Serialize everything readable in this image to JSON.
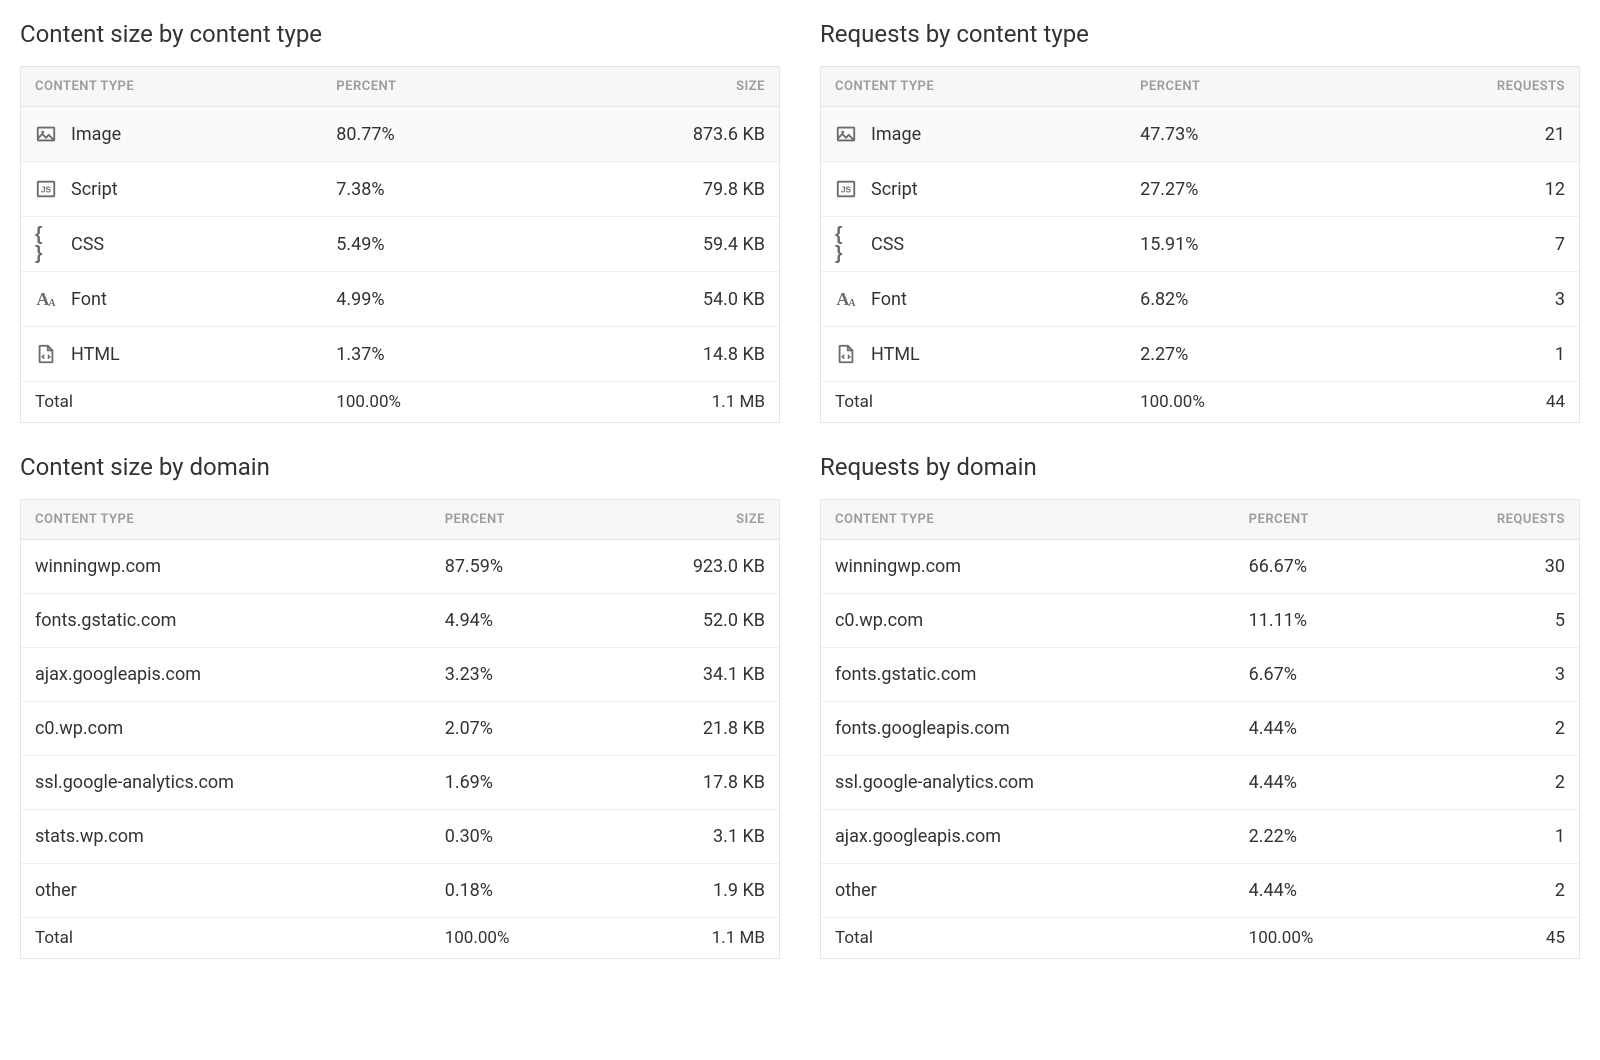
{
  "headers": {
    "content_type": "CONTENT TYPE",
    "percent": "PERCENT",
    "size": "SIZE",
    "requests": "REQUESTS"
  },
  "panels": {
    "size_by_type": {
      "title": "Content size by content type",
      "rows": [
        {
          "icon": "image-icon",
          "label": "Image",
          "percent": "80.77%",
          "value": "873.6 KB",
          "highlight": true
        },
        {
          "icon": "script-icon",
          "label": "Script",
          "percent": "7.38%",
          "value": "79.8 KB"
        },
        {
          "icon": "css-icon",
          "label": "CSS",
          "percent": "5.49%",
          "value": "59.4 KB"
        },
        {
          "icon": "font-icon",
          "label": "Font",
          "percent": "4.99%",
          "value": "54.0 KB"
        },
        {
          "icon": "html-icon",
          "label": "HTML",
          "percent": "1.37%",
          "value": "14.8 KB"
        }
      ],
      "total": {
        "label": "Total",
        "percent": "100.00%",
        "value": "1.1 MB"
      }
    },
    "requests_by_type": {
      "title": "Requests by content type",
      "rows": [
        {
          "icon": "image-icon",
          "label": "Image",
          "percent": "47.73%",
          "value": "21",
          "highlight": true
        },
        {
          "icon": "script-icon",
          "label": "Script",
          "percent": "27.27%",
          "value": "12"
        },
        {
          "icon": "css-icon",
          "label": "CSS",
          "percent": "15.91%",
          "value": "7"
        },
        {
          "icon": "font-icon",
          "label": "Font",
          "percent": "6.82%",
          "value": "3"
        },
        {
          "icon": "html-icon",
          "label": "HTML",
          "percent": "2.27%",
          "value": "1"
        }
      ],
      "total": {
        "label": "Total",
        "percent": "100.00%",
        "value": "44"
      }
    },
    "size_by_domain": {
      "title": "Content size by domain",
      "rows": [
        {
          "label": "winningwp.com",
          "percent": "87.59%",
          "value": "923.0 KB"
        },
        {
          "label": "fonts.gstatic.com",
          "percent": "4.94%",
          "value": "52.0 KB"
        },
        {
          "label": "ajax.googleapis.com",
          "percent": "3.23%",
          "value": "34.1 KB"
        },
        {
          "label": "c0.wp.com",
          "percent": "2.07%",
          "value": "21.8 KB"
        },
        {
          "label": "ssl.google-analytics.com",
          "percent": "1.69%",
          "value": "17.8 KB"
        },
        {
          "label": "stats.wp.com",
          "percent": "0.30%",
          "value": "3.1 KB"
        },
        {
          "label": "other",
          "percent": "0.18%",
          "value": "1.9 KB"
        }
      ],
      "total": {
        "label": "Total",
        "percent": "100.00%",
        "value": "1.1 MB"
      }
    },
    "requests_by_domain": {
      "title": "Requests by domain",
      "rows": [
        {
          "label": "winningwp.com",
          "percent": "66.67%",
          "value": "30"
        },
        {
          "label": "c0.wp.com",
          "percent": "11.11%",
          "value": "5"
        },
        {
          "label": "fonts.gstatic.com",
          "percent": "6.67%",
          "value": "3"
        },
        {
          "label": "fonts.googleapis.com",
          "percent": "4.44%",
          "value": "2"
        },
        {
          "label": "ssl.google-analytics.com",
          "percent": "4.44%",
          "value": "2"
        },
        {
          "label": "ajax.googleapis.com",
          "percent": "2.22%",
          "value": "1"
        },
        {
          "label": "other",
          "percent": "4.44%",
          "value": "2"
        }
      ],
      "total": {
        "label": "Total",
        "percent": "100.00%",
        "value": "45"
      }
    }
  }
}
